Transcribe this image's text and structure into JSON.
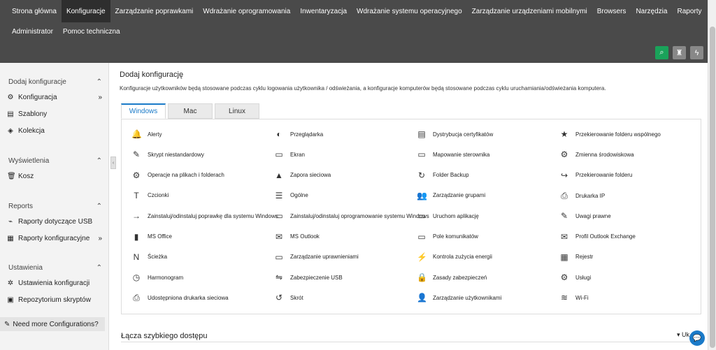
{
  "nav": {
    "row1": [
      "Strona główna",
      "Konfiguracje",
      "Zarządzanie poprawkami",
      "Wdrażanie oprogramowania",
      "Inwentaryzacja",
      "Wdrażanie systemu operacyjnego",
      "Zarządzanie urządzeniami mobilnymi",
      "Browsers",
      "Narzędzia",
      "Raporty"
    ],
    "row2": [
      "Administrator",
      "Pomoc techniczna"
    ],
    "active": "Konfiguracje"
  },
  "header_icons": [
    "search-icon",
    "rocket-icon",
    "bolt-icon"
  ],
  "sidebar": {
    "sections": [
      {
        "title": "Dodaj konfiguracje",
        "items": [
          {
            "label": "Konfiguracja",
            "icon": "gear-icon",
            "arrow": "»"
          },
          {
            "label": "Szablony",
            "icon": "template-icon",
            "arrow": ""
          },
          {
            "label": "Kolekcja",
            "icon": "collection-icon",
            "arrow": ""
          }
        ]
      },
      {
        "title": "Wyświetlenia",
        "items": [
          {
            "label": "Kosz",
            "icon": "trash-icon",
            "arrow": ""
          }
        ]
      },
      {
        "title": "Reports",
        "items": [
          {
            "label": "Raporty dotyczące USB",
            "icon": "usb-icon",
            "arrow": ""
          },
          {
            "label": "Raporty konfiguracyjne",
            "icon": "report-icon",
            "arrow": "»"
          }
        ]
      },
      {
        "title": "Ustawienia",
        "items": [
          {
            "label": "Ustawienia konfiguracji",
            "icon": "settings-icon",
            "arrow": ""
          },
          {
            "label": "Repozytorium skryptów",
            "icon": "repository-icon",
            "arrow": ""
          }
        ]
      }
    ],
    "bottom": "Need more Configurations?"
  },
  "main": {
    "title": "Dodaj konfigurację",
    "description": "Konfiguracje użytkowników będą stosowane podczas cyklu logowania użytkownika / odświeżania, a konfiguracje komputerów będą stosowane podczas cyklu uruchamiania/odświeżania komputera.",
    "tabs": [
      "Windows",
      "Mac",
      "Linux"
    ],
    "active_tab": "Windows",
    "columns": [
      [
        "Alerty",
        "Skrypt niestandardowy",
        "Operacje na plikach i folderach",
        "Czcionki",
        "Zainstaluj/odinstaluj poprawkę dla systemu Windows",
        "MS Office",
        "Ścieżka",
        "Harmonogram",
        "Udostępniona drukarka sieciowa"
      ],
      [
        "Przeglądarka",
        "Ekran",
        "Zapora sieciowa",
        "Ogólne",
        "Zainstaluj/odinstaluj oprogramowanie systemu Windows",
        "MS Outlook",
        "Zarządzanie uprawnieniami",
        "Zabezpieczenie USB",
        "Skrót"
      ],
      [
        "Dystrybucja certyfikatów",
        "Mapowanie sterownika",
        "Folder Backup",
        "Zarządzanie grupami",
        "Uruchom aplikację",
        "Pole komunikatów",
        "Kontrola zużycia energii",
        "Zasady zabezpieczeń",
        "Zarządzanie użytkownikami"
      ],
      [
        "Przekierowanie folderu wspólnego",
        "Zmienna środowiskowa",
        "Przekierowanie folderu",
        "Drukarka IP",
        "Uwagi prawne",
        "Profil Outlook Exchange",
        "Rejestr",
        "Usługi",
        "Wi-Fi"
      ]
    ]
  },
  "quick_links": {
    "title": "Łącza szybkiego dostępu",
    "right_label": "Uk"
  }
}
